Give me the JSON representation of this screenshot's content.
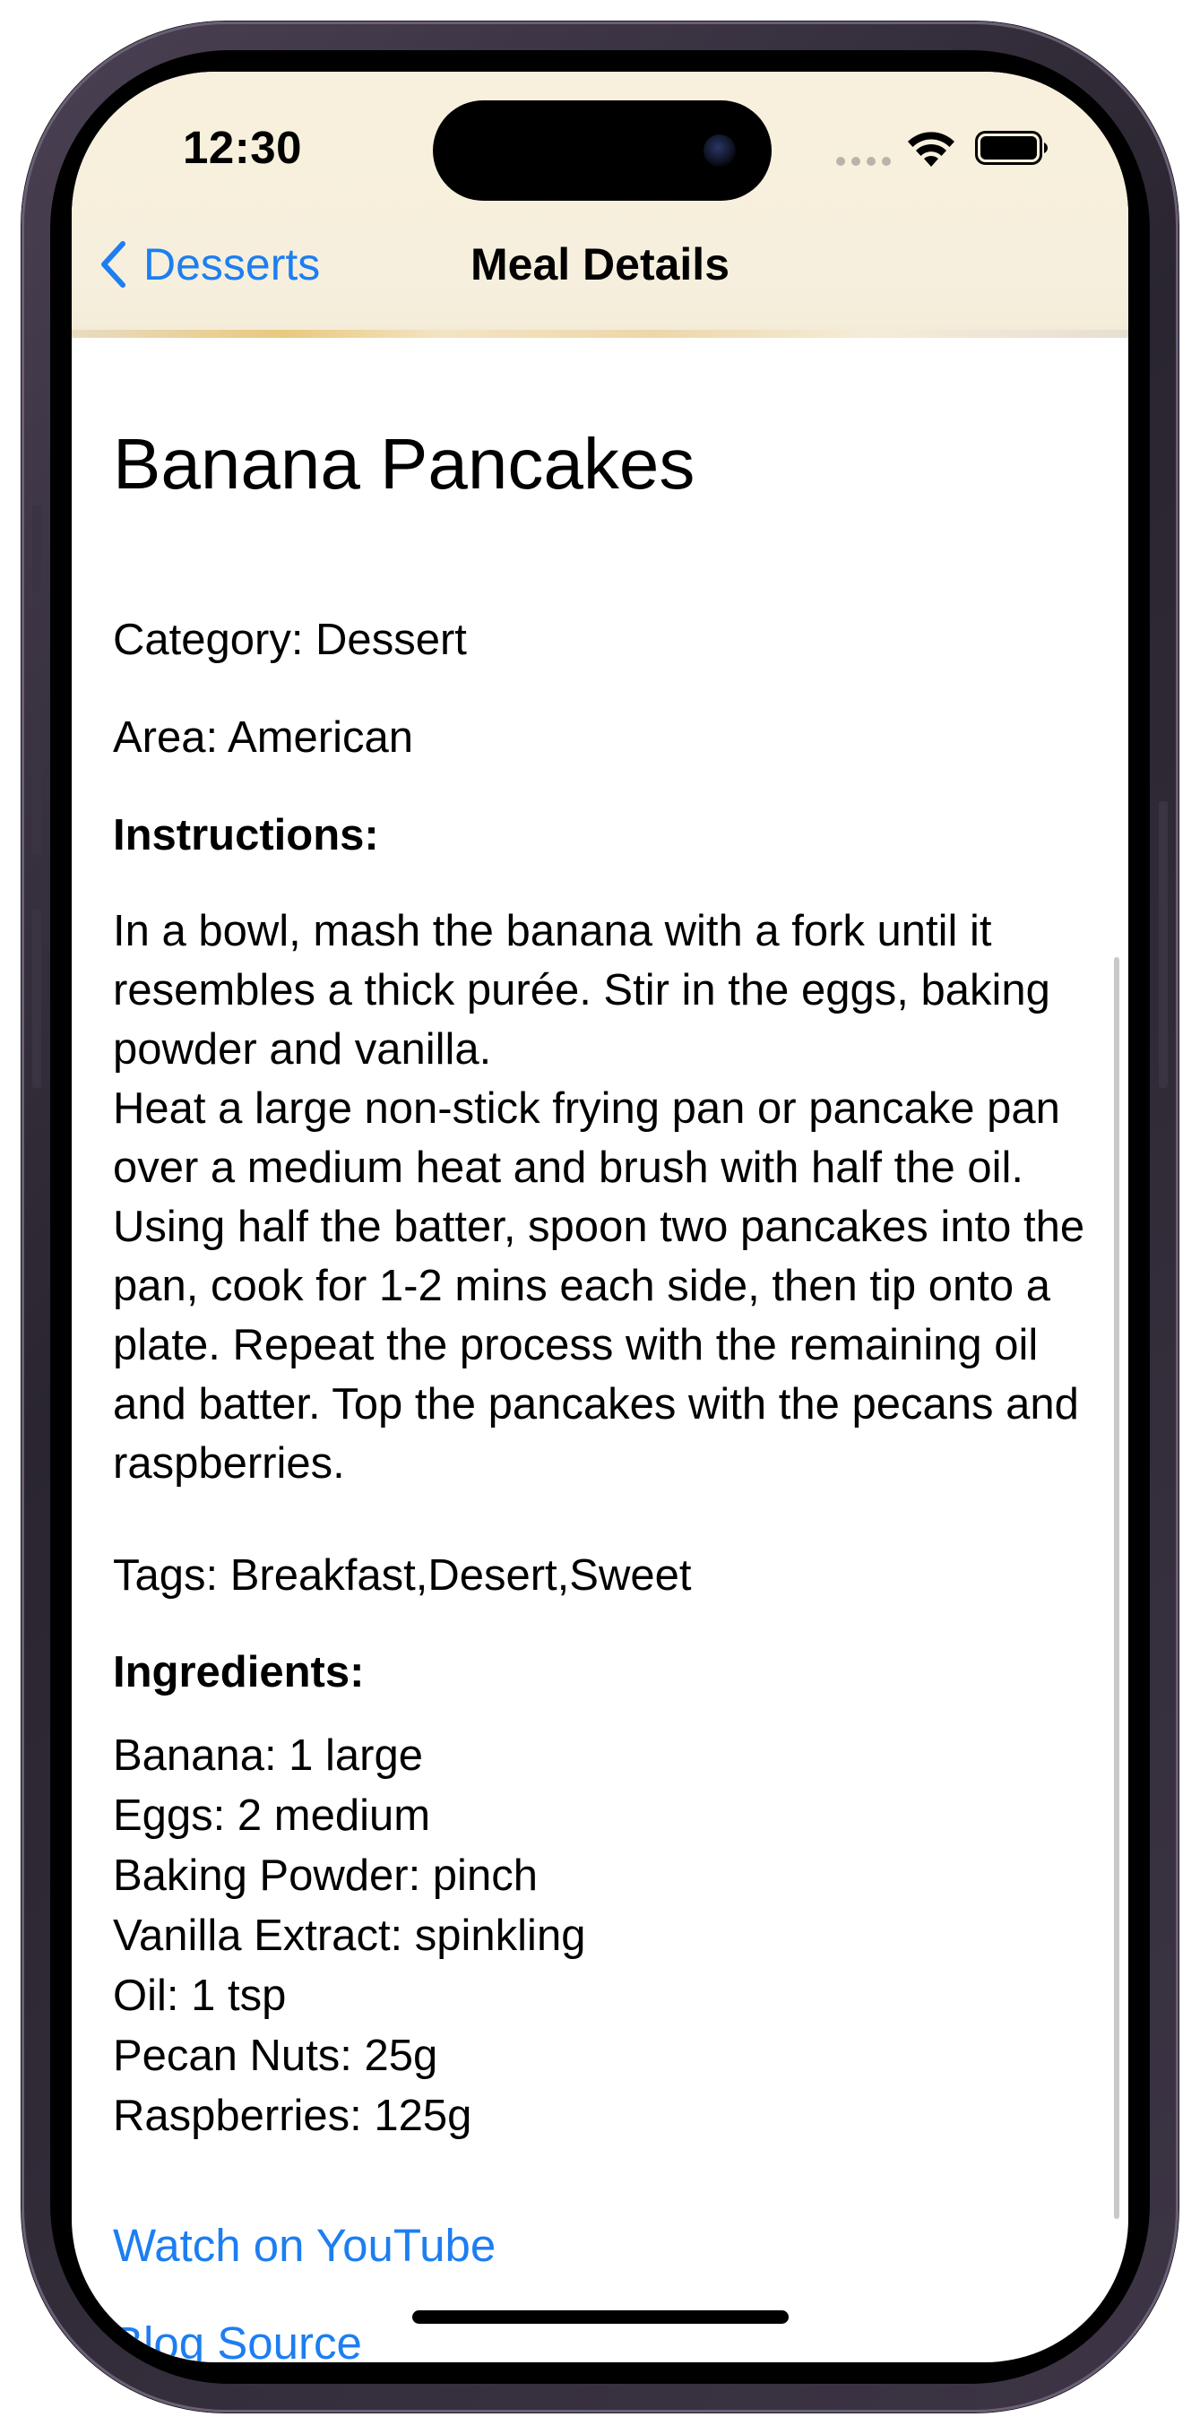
{
  "status_bar": {
    "time": "12:30",
    "icons": [
      "cellular-signal-icon",
      "wifi-icon",
      "battery-icon"
    ]
  },
  "nav": {
    "back_label": "Desserts",
    "title": "Meal Details"
  },
  "meal": {
    "name": "Banana Pancakes",
    "category_line": "Category: Dessert",
    "area_line": "Area: American",
    "instructions_header": "Instructions:",
    "instructions": "In a bowl, mash the banana with a fork until it resembles a thick purée. Stir in the eggs, baking powder and vanilla.\nHeat a large non-stick frying pan or pancake pan over a medium heat and brush with half the oil. Using half the batter, spoon two pancakes into the pan, cook for 1-2 mins each side, then tip onto a plate. Repeat the process with the remaining oil and batter. Top the pancakes with the pecans and raspberries.",
    "tags_line": "Tags: Breakfast,Desert,Sweet",
    "ingredients_header": "Ingredients:",
    "ingredients": [
      "Banana: 1 large",
      "Eggs: 2 medium",
      "Baking Powder: pinch",
      "Vanilla Extract: spinkling",
      "Oil: 1 tsp",
      "Pecan Nuts: 25g",
      "Raspberries: 125g"
    ]
  },
  "links": {
    "youtube": "Watch on YouTube",
    "blog": "Blog Source"
  },
  "colors": {
    "accent": "#1d7ef1",
    "header_background": "#f7efdc",
    "text": "#000000"
  }
}
